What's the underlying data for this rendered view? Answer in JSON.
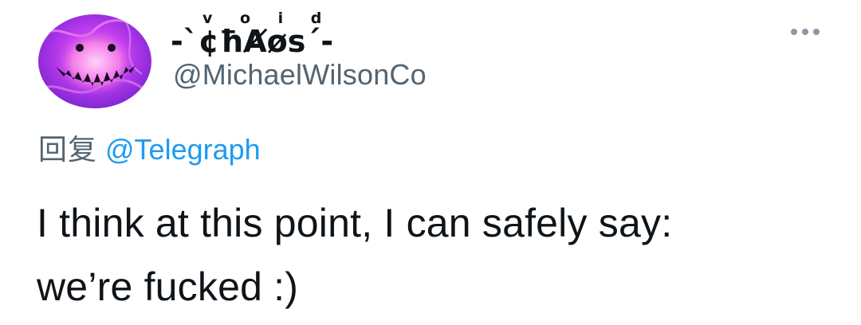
{
  "author": {
    "display_name": {
      "main": "-`¢ħȺøs´-",
      "above": "v o i d"
    },
    "handle": "@MichaelWilsonCo",
    "avatar_icon": "purple-grinning-monster-avatar"
  },
  "reply": {
    "label": "回复",
    "target": "@Telegraph"
  },
  "tweet": {
    "text": "I think at this point, I can safely say:\nwe’re fucked :)"
  },
  "actions": {
    "more_icon": "more-horizontal-icon"
  },
  "colors": {
    "text": "#0f1419",
    "muted": "#536471",
    "link": "#1d9bf0",
    "avatar_purple": "#a03cf0",
    "avatar_pink": "#f04cc8"
  }
}
